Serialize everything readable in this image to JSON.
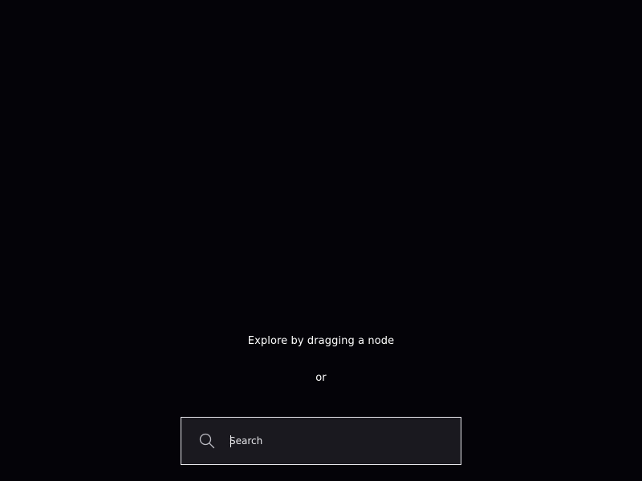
{
  "graph": {
    "hint": "Explore by dragging a node",
    "or_text": "or"
  },
  "search": {
    "placeholder": "Search",
    "value": ""
  },
  "icons": {
    "search": "search-icon"
  },
  "colors": {
    "background": "#040308",
    "search_background": "#1a191f",
    "search_border": "#e9e9ee",
    "text": "#ffffff"
  }
}
